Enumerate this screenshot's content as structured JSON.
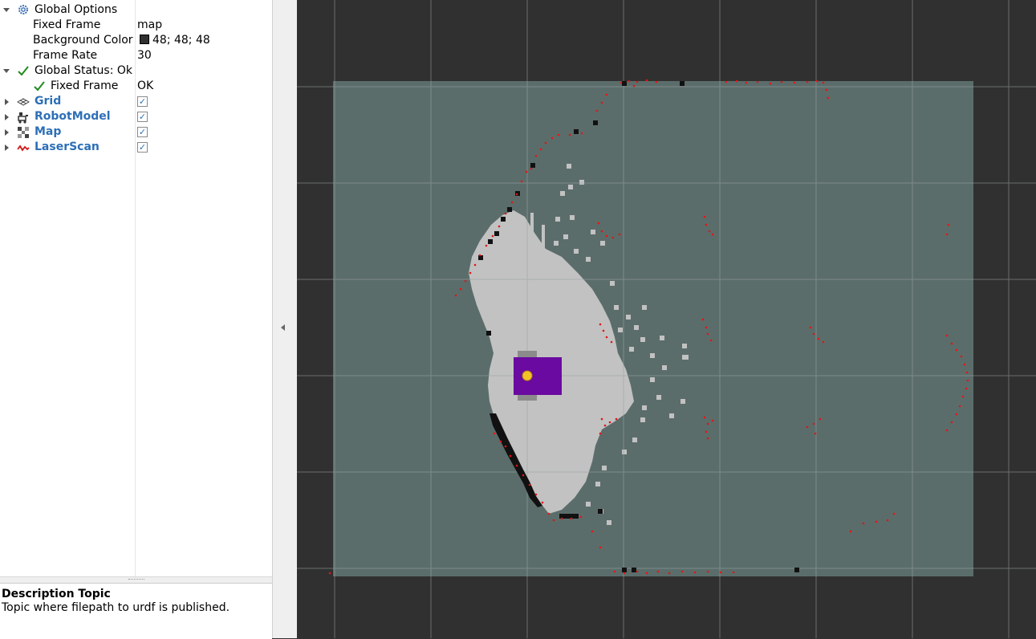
{
  "tree": {
    "global_options": {
      "label": "Global Options",
      "fixed_frame": {
        "label": "Fixed Frame",
        "value": "map"
      },
      "background_color": {
        "label": "Background Color",
        "value": "48; 48; 48",
        "swatch": "#303030"
      },
      "frame_rate": {
        "label": "Frame Rate",
        "value": "30"
      }
    },
    "global_status": {
      "label": "Global Status: Ok",
      "fixed_frame": {
        "label": "Fixed Frame",
        "value": "OK"
      }
    },
    "displays": [
      {
        "label": "Grid",
        "icon": "grid-icon",
        "checked": true
      },
      {
        "label": "RobotModel",
        "icon": "robot-model-icon",
        "checked": true
      },
      {
        "label": "Map",
        "icon": "map-icon",
        "checked": true
      },
      {
        "label": "LaserScan",
        "icon": "laser-scan-icon",
        "checked": true
      }
    ]
  },
  "description": {
    "title": "Description Topic",
    "text": "Topic where filepath to urdf is published."
  },
  "colors": {
    "view_background": "#303030",
    "map_free": "#5b6d6b",
    "map_unknown": "#c2c2c2",
    "obstacle": "#111111",
    "laser": "#e31515",
    "robot_body": "#6a0aa0",
    "robot_center": "#f5c225",
    "display_label": "#2d6fb7",
    "status_ok": "#1e8a1e"
  }
}
